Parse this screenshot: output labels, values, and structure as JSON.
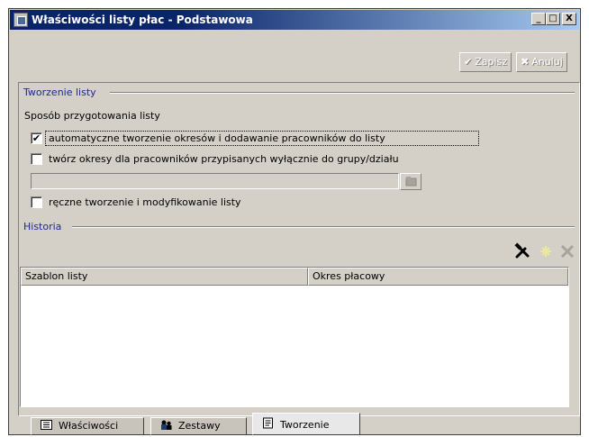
{
  "window": {
    "title": "Właściwości listy płac - Podstawowa",
    "controls": {
      "minimize": "_",
      "maximize": "□",
      "close": "X"
    }
  },
  "toolbar": {
    "save_label": "Zapisz",
    "cancel_label": "Anuluj",
    "save_icon": "✔",
    "cancel_icon": "✖"
  },
  "tworzenie": {
    "group_title": "Tworzenie listy",
    "method_label": "Sposób przygotowania listy",
    "options": [
      {
        "label": "automatyczne tworzenie okresów i dodawanie pracowników do listy",
        "checked": true,
        "mark": "✔"
      },
      {
        "label": "twórz okresy dla pracowników przypisanych wyłącznie do grupy/działu",
        "checked": false,
        "mark": ""
      },
      {
        "label": "ręczne tworzenie i modyfikowanie listy",
        "checked": false,
        "mark": ""
      }
    ],
    "group_field_value": ""
  },
  "historia": {
    "group_title": "Historia",
    "columns": [
      "Szablon listy",
      "Okres płacowy"
    ],
    "rows": []
  },
  "tabs": [
    {
      "label": "Właściwości",
      "icon": "list-icon",
      "active": false
    },
    {
      "label": "Zestawy",
      "icon": "people-icon",
      "active": false
    },
    {
      "label": "Tworzenie",
      "icon": "document-icon",
      "active": true
    }
  ],
  "colors": {
    "title_bar": "#0a246a",
    "group_title": "#1d2a8a",
    "window_face": "#d4d0c8"
  }
}
